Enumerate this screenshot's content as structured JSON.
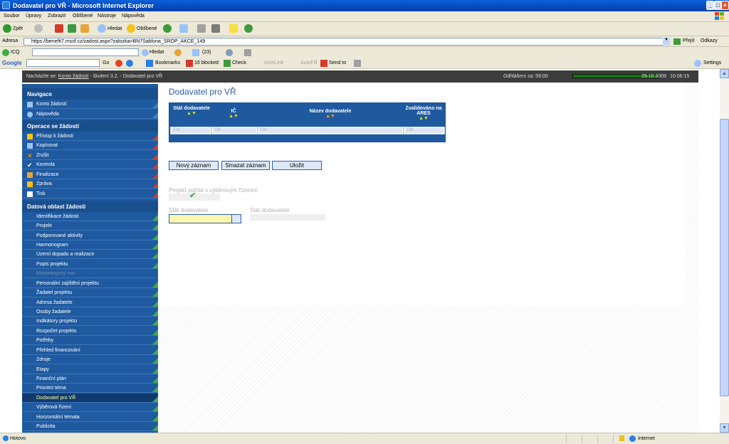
{
  "window": {
    "title": "Dodavatel pro VŘ - Microsoft Internet Explorer"
  },
  "menu": [
    "Soubor",
    "Úpravy",
    "Zobrazit",
    "Oblíbené",
    "Nástroje",
    "Nápověda"
  ],
  "toolbar": {
    "back": "Zpět",
    "search": "Hledat",
    "favorites": "Oblíbené"
  },
  "address": {
    "label": "Adresa",
    "url": "https://benefit7.mssf.cz/zadost.aspx?zalozka=BN7Sablona_SROP_AKCE_149",
    "go": "Přejít",
    "links": "Odkazy"
  },
  "icq": {
    "label": "ICQ",
    "search": "Hledat",
    "count": "(23)"
  },
  "google": {
    "label": "Google",
    "go": "Go",
    "bookmarks": "Bookmarks",
    "blocked": "16 blocked",
    "check": "Check",
    "autolink": "AutoLink",
    "autofill": "AutoFill",
    "sendto": "Send to",
    "settings": "Settings"
  },
  "topbar": {
    "breadcrumb_prefix": "Nacházíte se:",
    "breadcrumb_link": "Konto žádostí",
    "breadcrumb_rest": "- školení 3.2. - Dodavatel pro VŘ",
    "logout_label": "Odhlášení za: 59:00",
    "progress": 0.97,
    "date": "29.10.2009",
    "time": "10:06:15"
  },
  "sidebar": {
    "nav_header": "Navigace",
    "nav_items": [
      "Konto žádostí",
      "Nápověda"
    ],
    "ops_header": "Operace se žádostí",
    "ops_items": [
      "Přístup k žádosti",
      "Kopírovat",
      "Zrušit",
      "Kontrola",
      "Finalizace",
      "Zpráva",
      "Tisk"
    ],
    "data_header": "Datová oblast žádosti",
    "data_items": [
      "Identifikace žádosti",
      "Projekt",
      "Podporované aktivity",
      "Harmonogram",
      "Území dopadu a realizace",
      "Popis projektu",
      "Marketingový mix",
      "Personální zajištění projektu",
      "Žadatel projektu",
      "Adresa žadatele",
      "Osoby žadatele",
      "Indikátory projektu",
      "Rozpočet projektu",
      "Potřeby",
      "Přehled financování",
      "Zdroje",
      "Etapy",
      "Finanční plán",
      "Prioritní téma",
      "Dodavatel pro VŘ",
      "Výběrová řízení",
      "Horizontální témata",
      "Publicita"
    ]
  },
  "main": {
    "title": "Dodavatel pro VŘ",
    "columns": [
      "Stát dodavatele",
      "IČ",
      "Název dodavatele",
      "Zvalidováno na ARES"
    ],
    "filter_placeholder": "Filtr",
    "buttons": {
      "new": "Nový záznam",
      "delete": "Smazat záznam",
      "save": "Uložit"
    },
    "project_label": "Projekt počítá s výběrovým řízením",
    "field1_label": "Stát dodavatele",
    "field2_label": "Stát dodavatele"
  },
  "status": {
    "text": "Hotovo",
    "zone": "Internet"
  }
}
